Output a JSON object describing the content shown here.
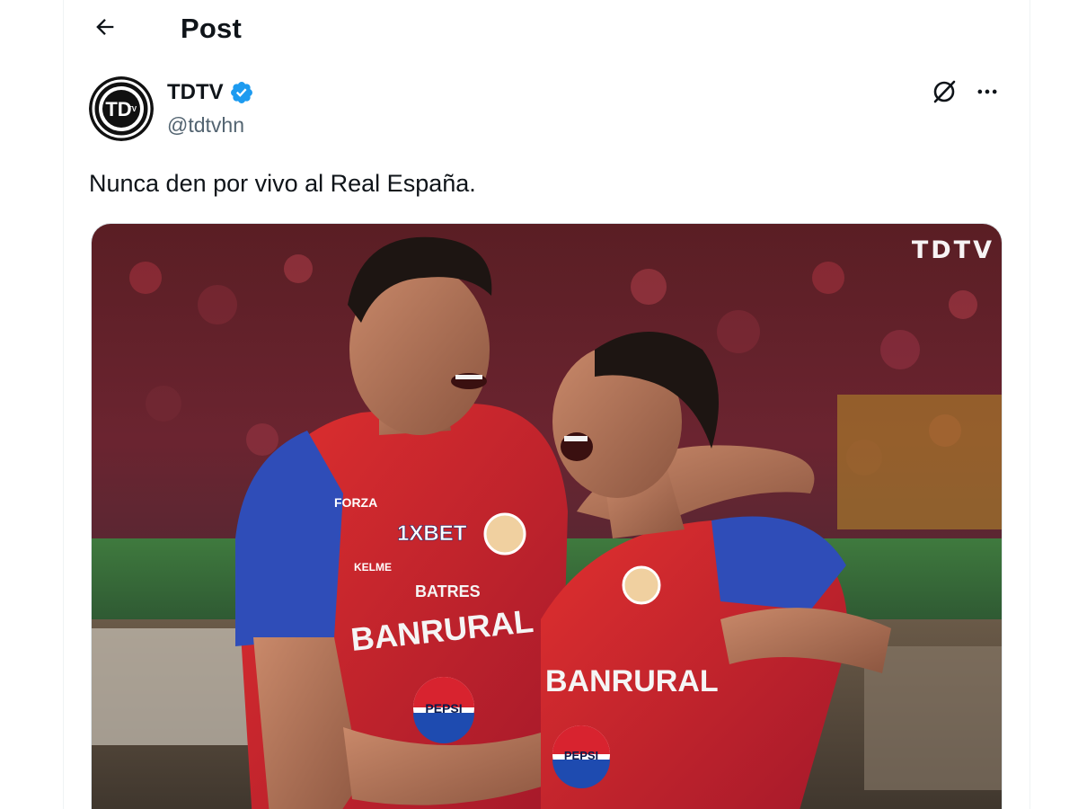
{
  "header": {
    "title": "Post"
  },
  "author": {
    "name": "TDTV",
    "handle": "@tdtvhn",
    "verified": true,
    "avatar_text": "TD",
    "avatar_sub": "TV"
  },
  "tweet": {
    "text": "Nunca den por vivo al Real España."
  },
  "media": {
    "watermark": "TDTV",
    "jersey_texts": {
      "sponsor_1": "1XBET",
      "sponsor_2": "BANRURAL",
      "sponsor_3": "PEPSI",
      "sponsor_4": "BATRES",
      "kit_brand": "KELME",
      "sleeve": "FORZA"
    }
  },
  "colors": {
    "accent": "#1d9bf0",
    "text_primary": "#0f1419",
    "text_secondary": "#536471",
    "jersey_red": "#d8232f",
    "jersey_blue": "#2f4db8"
  },
  "icons": {
    "back": "arrow-left-icon",
    "verified": "verified-badge-icon",
    "grok": "grok-icon",
    "more": "more-dots-icon"
  }
}
